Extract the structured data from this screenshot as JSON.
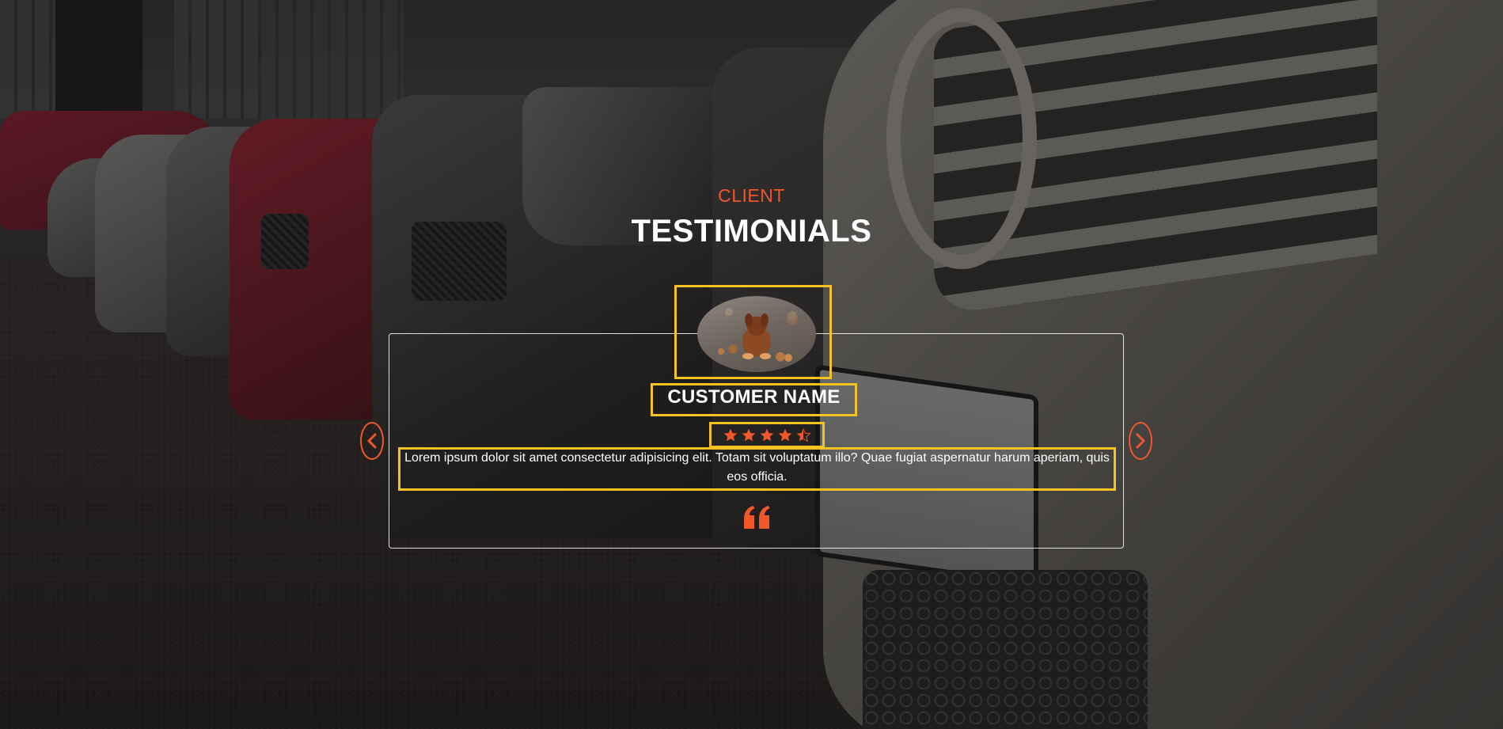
{
  "section": {
    "eyebrow": "CLIENT",
    "title": "TESTIMONIALS"
  },
  "testimonial": {
    "avatar_icon": "customer-avatar-photo",
    "customer_name": "CUSTOMER NAME",
    "rating": 4.5,
    "rating_max": 5,
    "text": "Lorem ipsum dolor sit amet consectetur adipisicing elit. Totam sit voluptatum illo? Quae fugiat aspernatur harum aperiam, quis eos officia.",
    "quote_icon": "quote-icon"
  },
  "carousel": {
    "prev_icon": "chevron-left-icon",
    "next_icon": "chevron-right-icon"
  },
  "colors": {
    "accent": "#f0572a",
    "highlight": "#f5c224",
    "text": "#ffffff"
  }
}
